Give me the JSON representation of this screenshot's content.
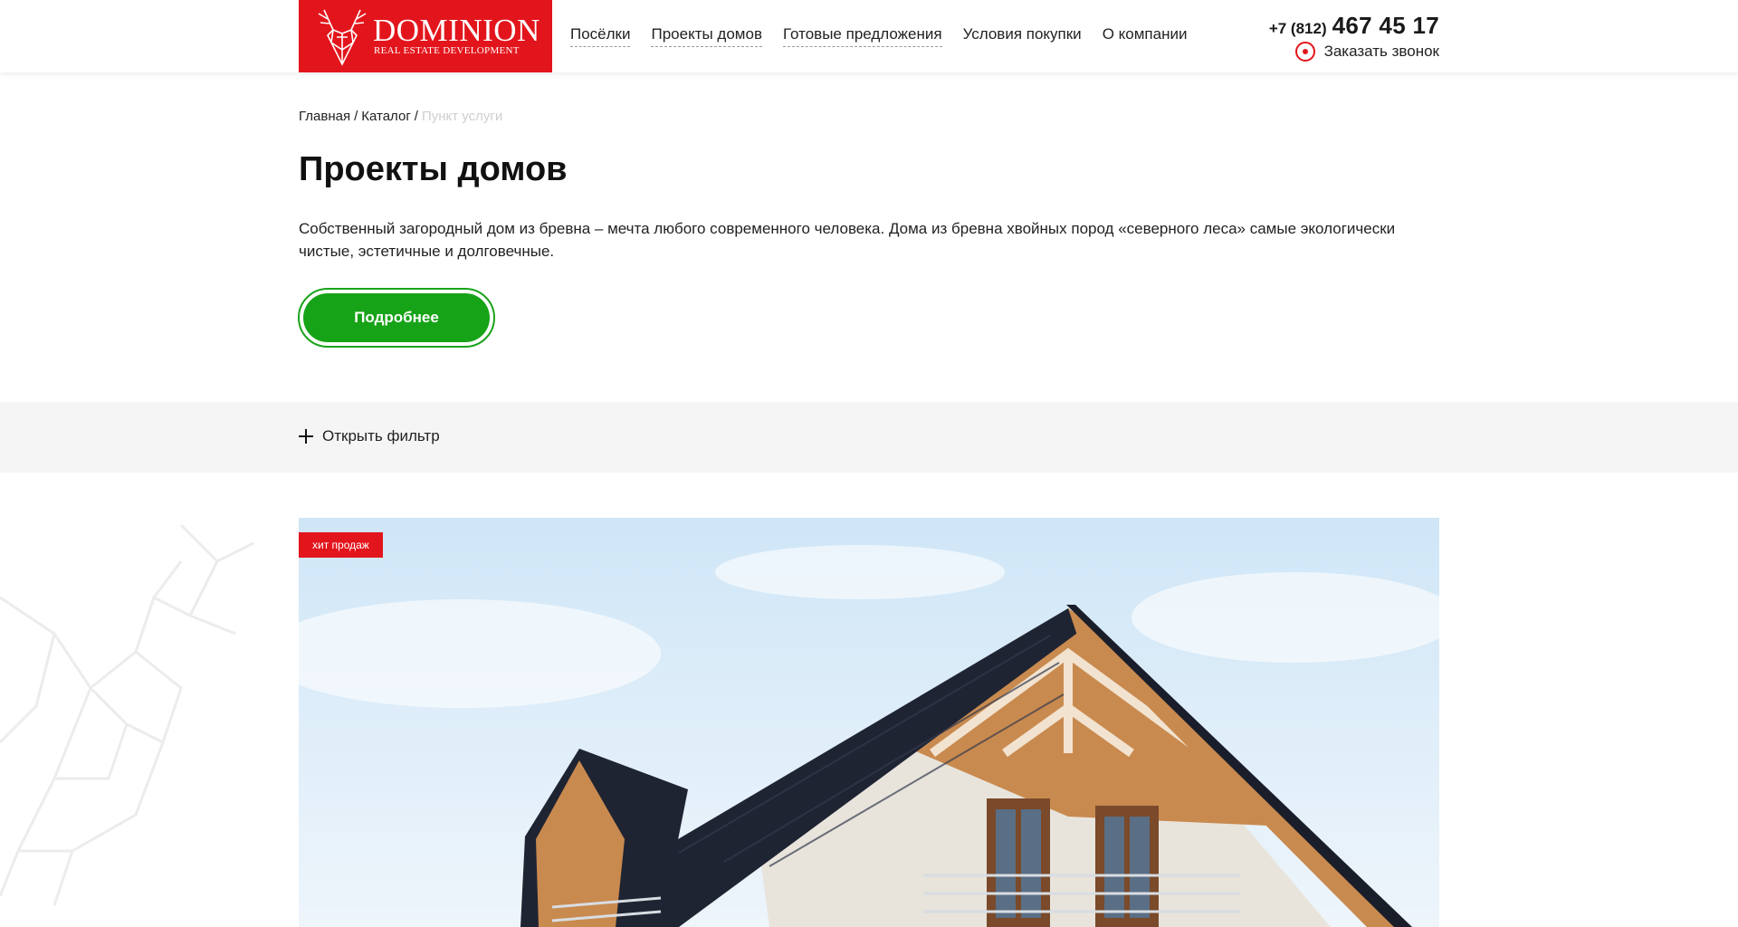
{
  "header": {
    "logo": {
      "title": "DOMINION",
      "subtitle": "REAL ESTATE DEVELOPMENT"
    },
    "nav": [
      {
        "label": "Посёлки"
      },
      {
        "label": "Проекты домов"
      },
      {
        "label": "Готовые предложения"
      },
      {
        "label": "Условия покупки"
      },
      {
        "label": "О компании"
      }
    ],
    "phone": {
      "code": "+7 (812)",
      "number": "467 45 17"
    },
    "callback_label": "Заказать звонок"
  },
  "breadcrumb": {
    "home": "Главная",
    "sep": "/",
    "catalog": "Каталог",
    "current": "Пункт услуги"
  },
  "page": {
    "title": "Проекты домов",
    "intro": "Собственный загородный дом из бревна – мечта любого современного человека. Дома из бревна хвойных пород «северного леса» самые экологически чистые, эстетичные и долговечные.",
    "more_button": "Подробнее"
  },
  "filter": {
    "toggle_label": "Открыть фильтр"
  },
  "card": {
    "badge": "хит продаж"
  },
  "colors": {
    "brand_red": "#e3151c",
    "button_green": "#17a317",
    "filter_bg": "#f5f5f5"
  }
}
